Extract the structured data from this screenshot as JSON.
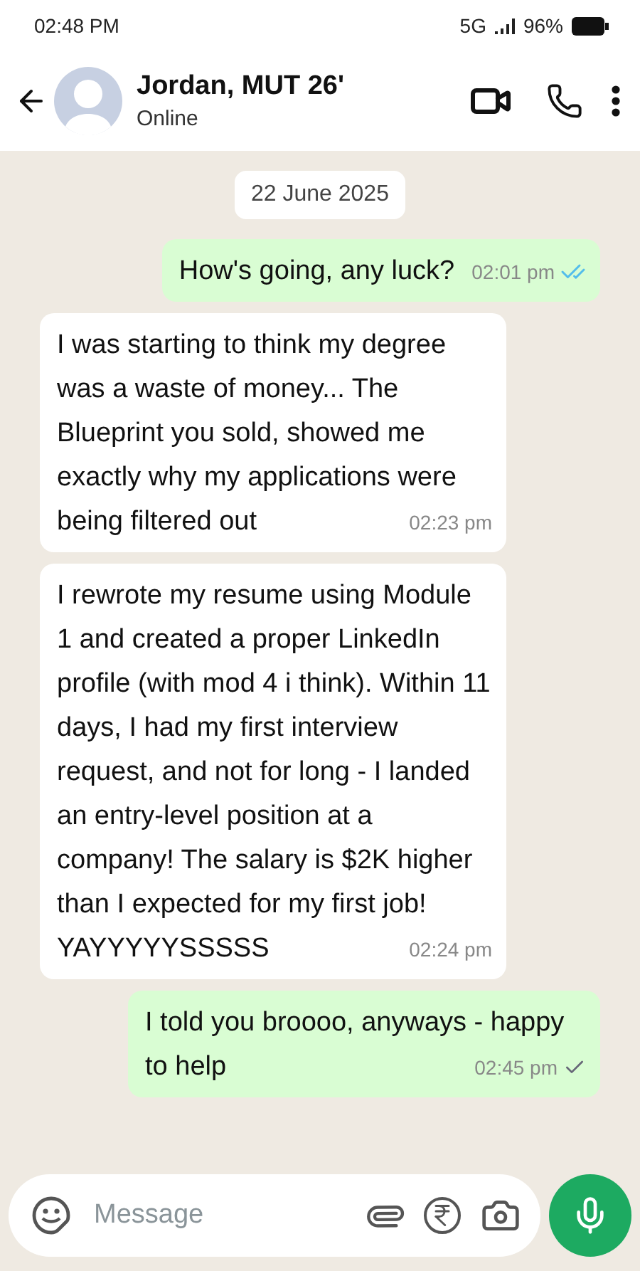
{
  "status_bar": {
    "time": "02:48 PM",
    "network": "5G",
    "battery": "96%"
  },
  "header": {
    "name": "Jordan, MUT 26'",
    "status": "Online"
  },
  "date_chip": "22 June 2025",
  "messages": [
    {
      "kind": "outgoing",
      "text": "How's going, any luck?",
      "time": "02:01 pm",
      "read": true
    },
    {
      "kind": "incoming",
      "text": " I was starting to think my degree was a waste of money... The Blueprint you sold, showed me exactly why my applications were being filtered out",
      "time": "02:23 pm"
    },
    {
      "kind": "incoming",
      "text": " I rewrote my resume using Module 1 and created a proper LinkedIn profile (with mod 4 i think). Within 11 days, I had my first interview request, and not for long - I landed an entry-level position at a company! The salary is $2K higher than I expected for my first job! YAYYYYYSSSSS",
      "time": "02:24 pm"
    },
    {
      "kind": "outgoing",
      "text": " I told you broooo, anyways - happy to help",
      "time": "02:45 pm",
      "read": false
    }
  ],
  "composer": {
    "placeholder": "Message"
  }
}
